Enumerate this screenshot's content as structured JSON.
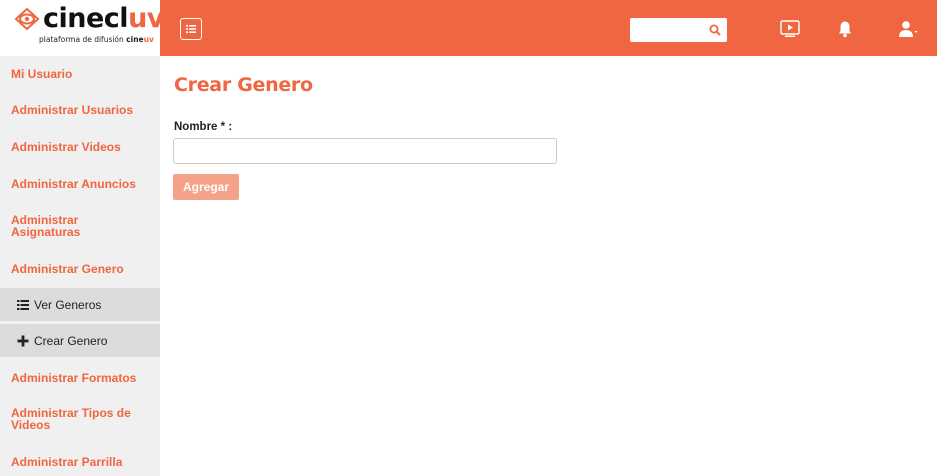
{
  "logo": {
    "name_prefix": "cinecl",
    "name_highlight": "uv",
    "tagline": "plataforma de difusión",
    "brand_prefix": "cine",
    "brand_highlight": "uv"
  },
  "topbar": {
    "search": {
      "value": "",
      "placeholder": ""
    },
    "icons": [
      "menu-icon",
      "search-icon",
      "tv-icon",
      "bell-icon",
      "user-icon"
    ]
  },
  "sidebar": {
    "items": [
      {
        "label": "Mi Usuario"
      },
      {
        "label": "Administrar Usuarios"
      },
      {
        "label": "Administrar Videos"
      },
      {
        "label": "Administrar Anuncios"
      },
      {
        "label": "Administrar Asignaturas"
      },
      {
        "label": "Administrar Genero"
      },
      {
        "label": "Administrar Formatos"
      },
      {
        "label": "Administrar Tipos de Videos"
      },
      {
        "label": "Administrar Parrilla"
      }
    ],
    "subitems": [
      {
        "label": "Ver Generos",
        "icon": "list-icon"
      },
      {
        "label": "Crear Genero",
        "icon": "plus-icon"
      }
    ]
  },
  "main": {
    "title": "Crear Genero",
    "form": {
      "nombre_label": "Nombre * :",
      "nombre_value": "",
      "nombre_placeholder": "",
      "submit_label": "Agregar"
    }
  },
  "colors": {
    "accent": "#ef6640",
    "accent_light": "#f4a288",
    "sidebar_bg": "#f0f0f0",
    "submenu_bg": "#dcdcdc"
  }
}
